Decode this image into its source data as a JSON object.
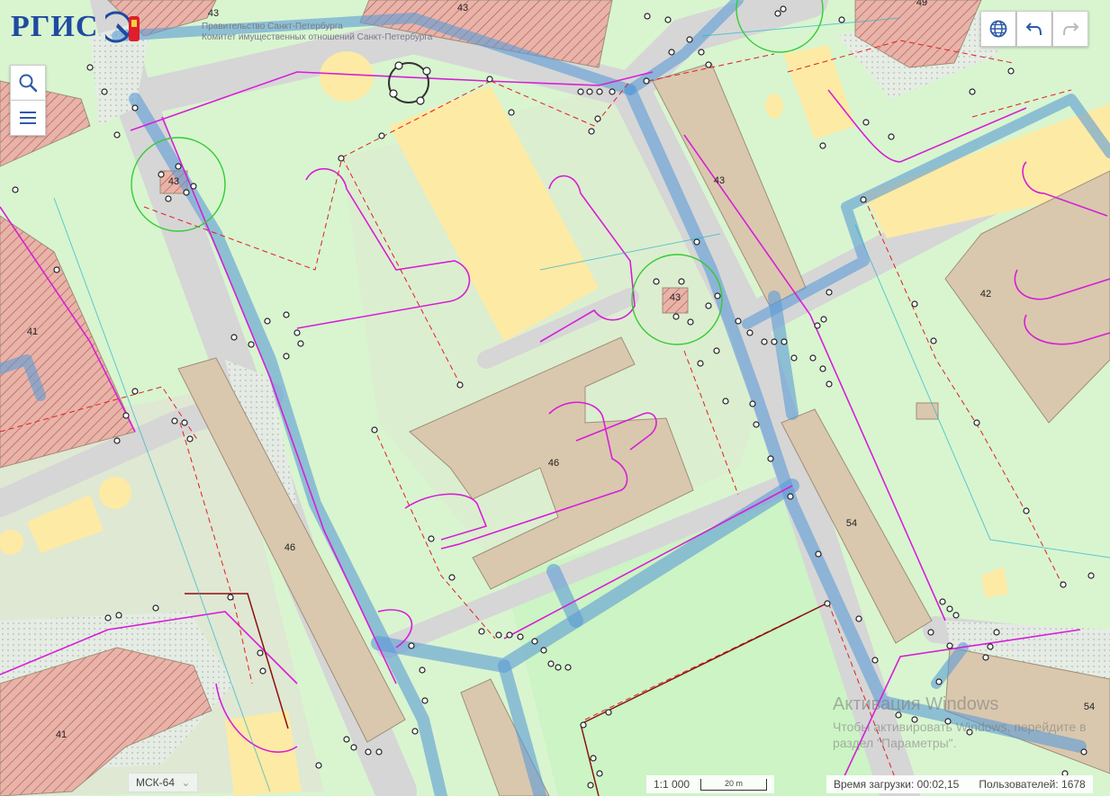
{
  "app": {
    "logo_text": "РГИС",
    "org_line1": "Правительство Санкт-Петербурга",
    "org_line2": "Комитет имущественных отношений Санкт-Петербурга"
  },
  "toolbar": {
    "search_icon": "search-icon",
    "menu_icon": "menu-icon",
    "globe_icon": "globe-icon",
    "undo_icon": "undo-icon",
    "redo_icon": "redo-icon"
  },
  "map": {
    "building_labels": [
      "43",
      "43",
      "43",
      "43",
      "43",
      "49",
      "42",
      "41",
      "41",
      "46",
      "46",
      "54",
      "54"
    ]
  },
  "status": {
    "projection": "МСК-64",
    "scale": "1:1 000",
    "scalebar_label": "20 m",
    "load_time": "Время загрузки: 00:02,15",
    "users": "Пользователей: 1678"
  },
  "watermark": {
    "title": "Активация Windows",
    "line1": "Чтобы активировать Windows, перейдите в",
    "line2": "раздел \"Параметры\"."
  },
  "colors": {
    "background": "#d8f5d0",
    "building": "#d9c8ae",
    "hatched": "#e8b3a8",
    "yellow": "#fdeaa5",
    "pipe": "#5b9bd5",
    "magenta": "#d61fd6",
    "red_dashed": "#e02020"
  }
}
